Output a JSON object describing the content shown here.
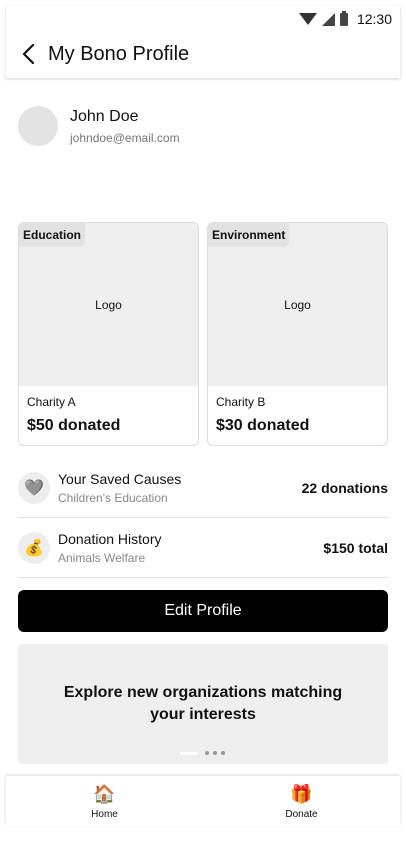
{
  "status_bar": {
    "time": "12:30",
    "icons": [
      "wifi-icon",
      "signal-icon",
      "battery-icon"
    ]
  },
  "header": {
    "title": "My Bono Profile",
    "back_icon": "chevron-left-icon"
  },
  "profile": {
    "name": "John Doe",
    "email": "johndoe@email.com"
  },
  "charities": [
    {
      "tag": "Education",
      "logo": "Logo",
      "name": "Charity A",
      "amount": "$50 donated"
    },
    {
      "tag": "Environment",
      "logo": "Logo",
      "name": "Charity B",
      "amount": "$30 donated"
    }
  ],
  "rows": [
    {
      "icon": "heart-icon",
      "glyph": "🩶",
      "title": "Your Saved Causes",
      "subtitle": "Children's Education",
      "value": "22 donations"
    },
    {
      "icon": "money-bag-icon",
      "glyph": "💰",
      "title": "Donation History",
      "subtitle": "Animals Welfare",
      "value": "$150 total"
    }
  ],
  "edit_button": {
    "label": "Edit Profile"
  },
  "banner": {
    "text": "Explore new organizations matching your interests",
    "pages": 4,
    "active_page": 1
  },
  "bottom_nav": [
    {
      "label": "Home",
      "icon": "home-icon",
      "glyph": "🏠"
    },
    {
      "label": "Donate",
      "icon": "gift-icon",
      "glyph": "🎁"
    }
  ]
}
